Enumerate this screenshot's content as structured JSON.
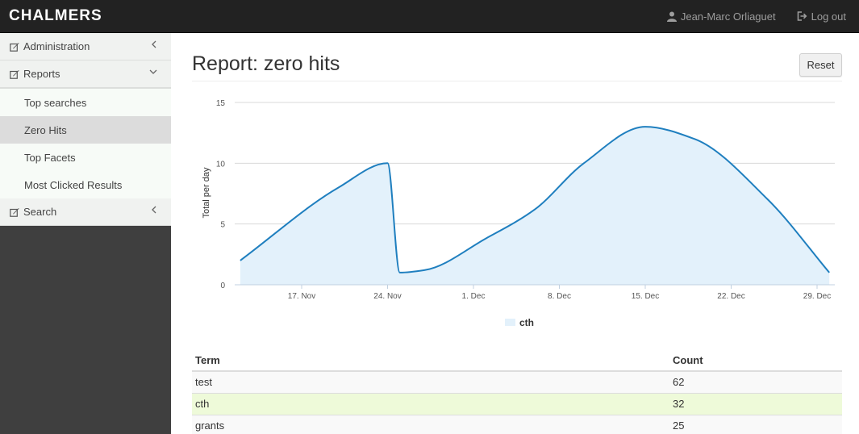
{
  "header": {
    "brand": "CHALMERS",
    "user": "Jean-Marc Orliaguet",
    "logout": "Log out"
  },
  "sidebar": {
    "sections": [
      {
        "label": "Administration",
        "chevron": "chevron-left"
      },
      {
        "label": "Reports",
        "chevron": "chevron-down"
      },
      {
        "label": "Search",
        "chevron": "chevron-left"
      }
    ],
    "report_items": [
      "Top searches",
      "Zero Hits",
      "Top Facets",
      "Most Clicked Results"
    ],
    "active_item": "Zero Hits"
  },
  "main": {
    "title": "Report: zero hits",
    "reset_label": "Reset"
  },
  "chart_data": {
    "type": "area",
    "ylabel": "Total per day",
    "ylim": [
      0,
      15
    ],
    "yticks": [
      0,
      5,
      10,
      15
    ],
    "x_ticks": [
      "17. Nov",
      "24. Nov",
      "1. Dec",
      "8. Dec",
      "15. Dec",
      "22. Dec",
      "29. Dec"
    ],
    "grid": true,
    "legend_position": "bottom-center",
    "series": [
      {
        "name": "cth",
        "color": "#1f7fbf",
        "fill": "#e3f1fb",
        "points": [
          [
            "2013-11-12",
            2
          ],
          [
            "2013-11-20",
            8
          ],
          [
            "2013-11-24",
            10
          ],
          [
            "2013-11-25",
            1
          ],
          [
            "2013-11-27",
            1.2
          ],
          [
            "2013-12-02",
            3.8
          ],
          [
            "2013-12-06",
            6.2
          ],
          [
            "2013-12-10",
            10
          ],
          [
            "2013-12-15",
            13
          ],
          [
            "2013-12-19",
            12
          ],
          [
            "2013-12-25",
            7
          ],
          [
            "2013-12-30",
            1
          ]
        ]
      }
    ]
  },
  "table": {
    "headers": {
      "term": "Term",
      "count": "Count"
    },
    "rows": [
      {
        "term": "test",
        "count": "62"
      },
      {
        "term": "cth",
        "count": "32"
      },
      {
        "term": "grants",
        "count": "25"
      }
    ]
  }
}
